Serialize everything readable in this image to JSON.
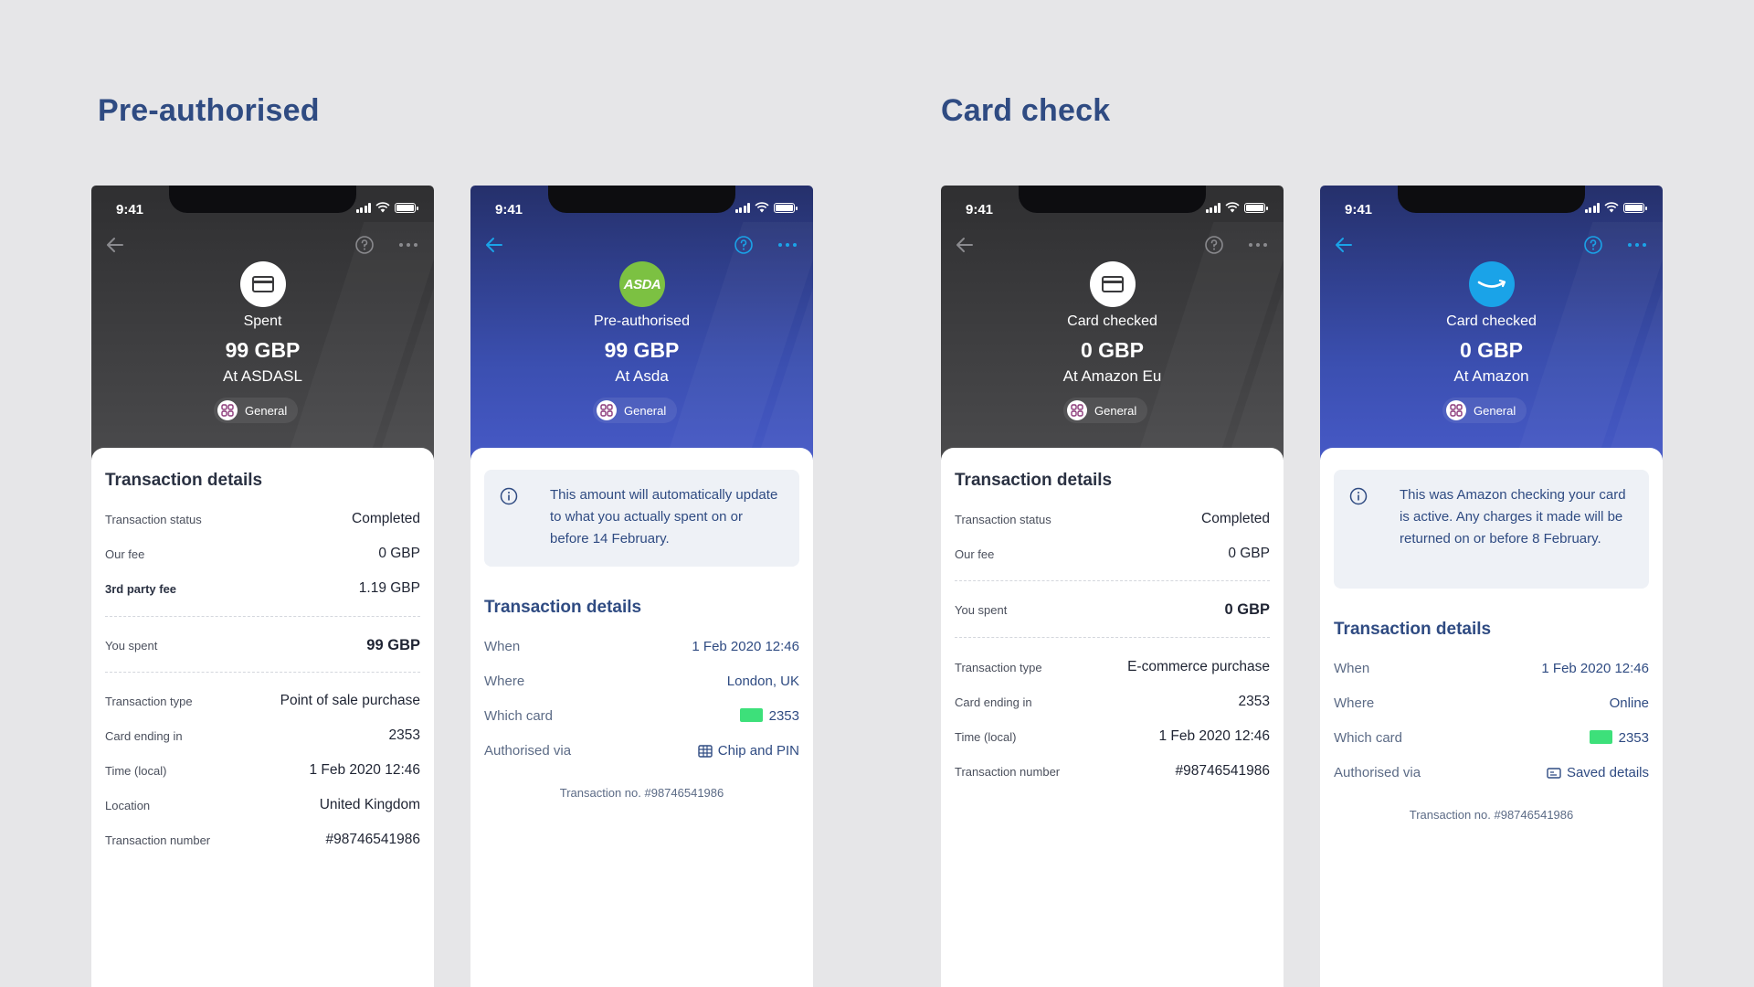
{
  "sections": {
    "pre_authorised": "Pre-authorised",
    "card_check": "Card check"
  },
  "screens": [
    {
      "time": "9:41",
      "label": "Spent",
      "amount": "99 GBP",
      "merchant": "At ASDASL",
      "category": "General",
      "details_title": "Transaction details",
      "rows": [
        {
          "label": "Transaction status",
          "value": "Completed"
        },
        {
          "label": "Our fee",
          "value": "0 GBP"
        },
        {
          "label": "3rd party fee",
          "value": "1.19 GBP"
        },
        {
          "label": "You spent",
          "value": "99 GBP"
        },
        {
          "label": "Transaction type",
          "value": "Point of sale purchase"
        },
        {
          "label": "Card ending in",
          "value": "2353"
        },
        {
          "label": "Time (local)",
          "value": "1 Feb 2020 12:46"
        },
        {
          "label": "Location",
          "value": "United Kingdom"
        },
        {
          "label": "Transaction number",
          "value": "#98746541986"
        }
      ]
    },
    {
      "time": "9:41",
      "merchant_logo_text": "ASDA",
      "label": "Pre-authorised",
      "amount": "99 GBP",
      "merchant": "At Asda",
      "category": "General",
      "info": "This amount will automatically update to what you actually spent on or before 14 February.",
      "details_title": "Transaction details",
      "rows": [
        {
          "label": "When",
          "value": "1 Feb 2020 12:46"
        },
        {
          "label": "Where",
          "value": "London, UK"
        },
        {
          "label": "Which card",
          "value": "2353"
        },
        {
          "label": "Authorised via",
          "value": "Chip and PIN"
        }
      ],
      "transaction_no": "Transaction no. #98746541986"
    },
    {
      "time": "9:41",
      "label": "Card checked",
      "amount": "0 GBP",
      "merchant": "At Amazon Eu",
      "category": "General",
      "details_title": "Transaction details",
      "rows": [
        {
          "label": "Transaction status",
          "value": "Completed"
        },
        {
          "label": "Our fee",
          "value": "0 GBP"
        },
        {
          "label": "You spent",
          "value": "0 GBP"
        },
        {
          "label": "Transaction type",
          "value": "E-commerce purchase"
        },
        {
          "label": "Card ending in",
          "value": "2353"
        },
        {
          "label": "Time (local)",
          "value": "1 Feb 2020 12:46"
        },
        {
          "label": "Transaction number",
          "value": "#98746541986"
        }
      ]
    },
    {
      "time": "9:41",
      "label": "Card checked",
      "amount": "0 GBP",
      "merchant": "At Amazon",
      "category": "General",
      "info": "This was Amazon checking your card is active. Any charges it made will be returned on or before 8 February.",
      "details_title": "Transaction details",
      "rows": [
        {
          "label": "When",
          "value": "1 Feb 2020 12:46"
        },
        {
          "label": "Where",
          "value": "Online"
        },
        {
          "label": "Which card",
          "value": "2353"
        },
        {
          "label": "Authorised via",
          "value": "Saved details"
        }
      ],
      "transaction_no": "Transaction no. #98746541986"
    }
  ],
  "icons": {
    "back": "arrow-left-icon",
    "help": "question-circle-icon",
    "more": "more-dots-icon",
    "info": "info-circle-icon",
    "category": "grid-icon",
    "card": "credit-card-icon",
    "chip_pin": "chip-and-pin-icon",
    "saved": "saved-details-icon"
  },
  "colors": {
    "section_title": "#2f4b82",
    "dark_header": "#3a3a3c",
    "blue_header": "#3b4fb0",
    "accent_blue": "#1aa3e8",
    "card_chip": "#3de07a",
    "asda_green": "#7cc142"
  }
}
